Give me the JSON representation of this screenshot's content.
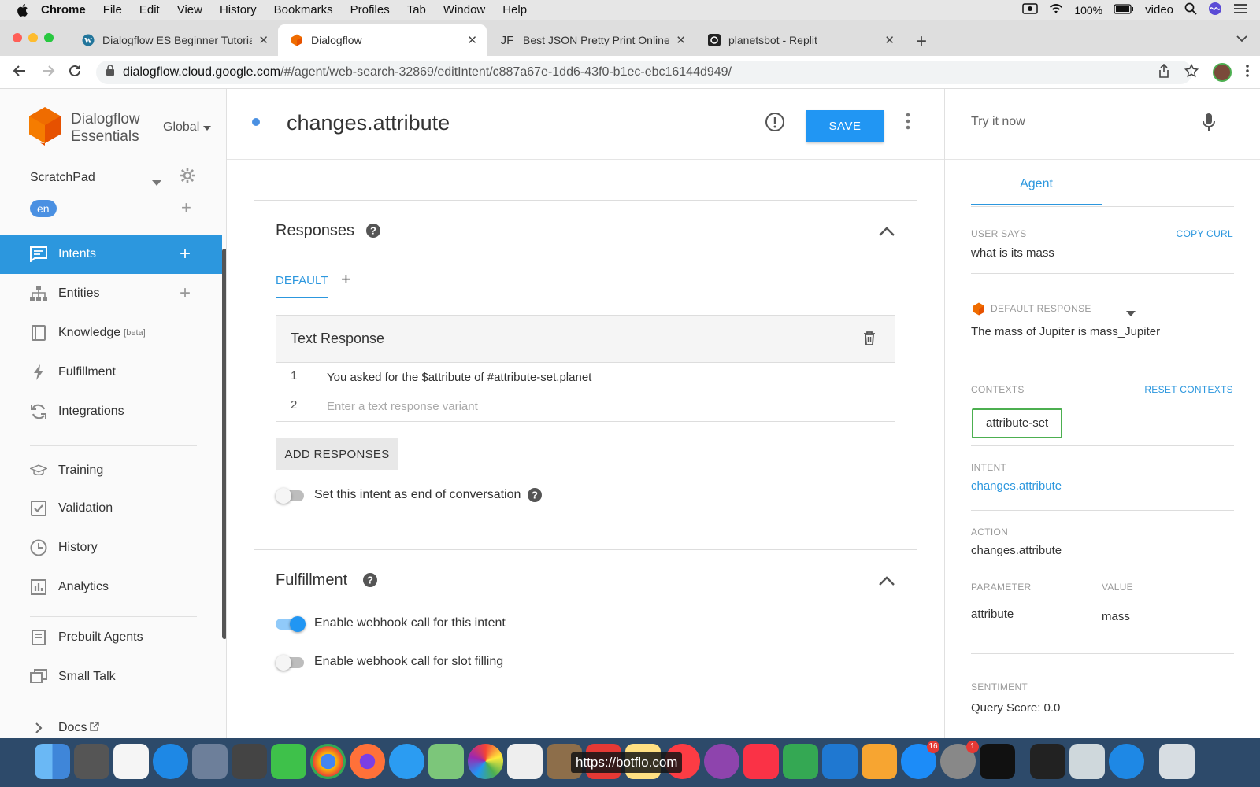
{
  "menubar": {
    "app": "Chrome",
    "items": [
      "File",
      "Edit",
      "View",
      "History",
      "Bookmarks",
      "Profiles",
      "Tab",
      "Window",
      "Help"
    ],
    "battery": "100%",
    "user": "video"
  },
  "tabs": [
    {
      "title": "Dialogflow ES Beginner Tutoria",
      "icon": "wordpress-icon"
    },
    {
      "title": "Dialogflow",
      "icon": "dialogflow-icon",
      "active": true
    },
    {
      "title": "Best JSON Pretty Print Online",
      "icon": "jf-icon",
      "icon_text": "JF"
    },
    {
      "title": "planetsbot - Replit",
      "icon": "replit-icon"
    }
  ],
  "address": {
    "host": "dialogflow.cloud.google.com",
    "path": "/#/agent/web-search-32869/editIntent/c887a67e-1dd6-43f0-b1ec-ebc16144d949/"
  },
  "sidebar": {
    "brand_line1": "Dialogflow",
    "brand_line2": "Essentials",
    "region": "Global",
    "agent_name": "ScratchPad",
    "language": "en",
    "items": [
      {
        "label": "Intents",
        "icon": "chat-icon",
        "plus": true,
        "active": true
      },
      {
        "label": "Entities",
        "icon": "hierarchy-icon",
        "plus": true
      },
      {
        "label": "Knowledge",
        "icon": "book-icon",
        "sup": "[beta]"
      },
      {
        "label": "Fulfillment",
        "icon": "bolt-icon"
      },
      {
        "label": "Integrations",
        "icon": "refresh-icon"
      },
      {
        "label": "Training",
        "icon": "graduation-cap-icon"
      },
      {
        "label": "Validation",
        "icon": "check-box-icon"
      },
      {
        "label": "History",
        "icon": "clock-icon"
      },
      {
        "label": "Analytics",
        "icon": "bar-chart-icon"
      },
      {
        "label": "Prebuilt Agents",
        "icon": "prebuilt-icon"
      },
      {
        "label": "Small Talk",
        "icon": "chat-bubbles-icon"
      },
      {
        "label": "Docs",
        "icon": "chevron-right-icon"
      }
    ]
  },
  "header": {
    "intent_name": "changes.attribute",
    "save_label": "SAVE"
  },
  "responses": {
    "title": "Responses",
    "tab_default": "DEFAULT",
    "card_title": "Text Response",
    "rows": [
      {
        "num": "1",
        "text": "You asked for the $attribute of #attribute-set.planet"
      },
      {
        "num": "2",
        "text": ""
      }
    ],
    "placeholder": "Enter a text response variant",
    "add_button": "ADD RESPONSES",
    "end_conversation_label": "Set this intent as end of conversation",
    "end_conversation_on": false
  },
  "fulfillment": {
    "title": "Fulfillment",
    "webhook_label": "Enable webhook call for this intent",
    "webhook_on": true,
    "slot_label": "Enable webhook call for slot filling",
    "slot_on": false
  },
  "try_panel": {
    "placeholder": "Try it now",
    "agent_tab": "Agent",
    "user_says_label": "USER SAYS",
    "copy_curl": "COPY CURL",
    "user_says": "what is its mass",
    "default_response_label": "DEFAULT RESPONSE",
    "default_response": "The mass of Jupiter is mass_Jupiter",
    "contexts_label": "CONTEXTS",
    "reset_contexts": "RESET CONTEXTS",
    "context_chip": "attribute-set",
    "intent_label": "INTENT",
    "intent_value": "changes.attribute",
    "action_label": "ACTION",
    "action_value": "changes.attribute",
    "parameter_label": "PARAMETER",
    "value_label": "VALUE",
    "parameter": "attribute",
    "value": "mass",
    "sentiment_label": "SENTIMENT",
    "query_score": "Query Score: 0.0"
  },
  "dock": {
    "hover_url": "https://botflo.com",
    "badges": {
      "appstore": "16",
      "settings": "1"
    }
  },
  "colors": {
    "accent": "#2c97de",
    "save": "#2196f3",
    "context_border": "#4caf50",
    "dialogflow_orange": "#ef6c00"
  }
}
